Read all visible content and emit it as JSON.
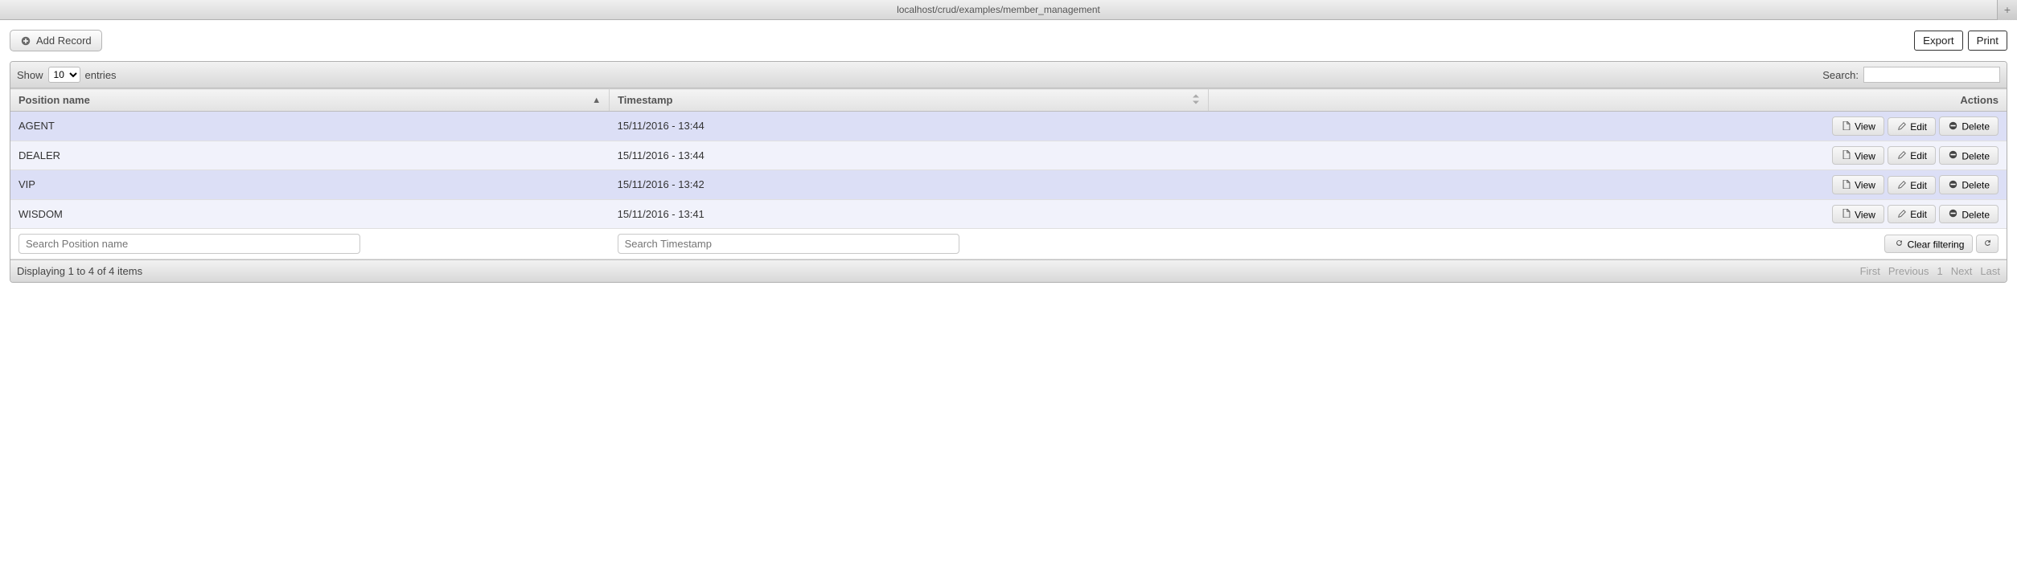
{
  "browser": {
    "url": "localhost/crud/examples/member_management"
  },
  "toolbar": {
    "add_label": "Add Record",
    "export_label": "Export",
    "print_label": "Print"
  },
  "datatable": {
    "show_prefix": "Show",
    "show_suffix": "entries",
    "length_value": "10",
    "search_label": "Search:",
    "columns": {
      "position": "Position name",
      "timestamp": "Timestamp",
      "actions": "Actions"
    },
    "rows": [
      {
        "position": "AGENT",
        "timestamp": "15/11/2016 - 13:44"
      },
      {
        "position": "DEALER",
        "timestamp": "15/11/2016 - 13:44"
      },
      {
        "position": "VIP",
        "timestamp": "15/11/2016 - 13:42"
      },
      {
        "position": "WISDOM",
        "timestamp": "15/11/2016 - 13:41"
      }
    ],
    "row_actions": {
      "view": "View",
      "edit": "Edit",
      "delete": "Delete"
    },
    "filters": {
      "position_placeholder": "Search Position name",
      "timestamp_placeholder": "Search Timestamp",
      "clear_label": "Clear filtering"
    },
    "footer": {
      "info": "Displaying 1 to 4 of 4 items",
      "first": "First",
      "prev": "Previous",
      "page": "1",
      "next": "Next",
      "last": "Last"
    }
  }
}
